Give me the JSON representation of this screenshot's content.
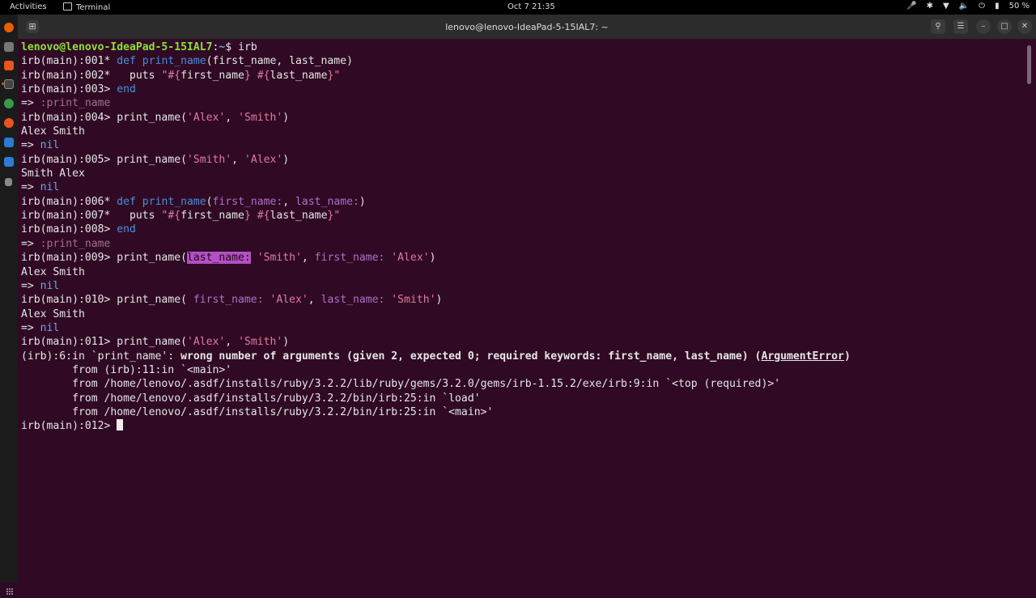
{
  "topbar": {
    "activities": "Activities",
    "app_name": "Terminal",
    "clock": "Oct 7  21:35",
    "battery": "50 %",
    "tray_icons": [
      "microphone-icon",
      "bluetooth-icon",
      "wifi-icon",
      "volume-icon",
      "power-icon",
      "battery-icon"
    ]
  },
  "dock": {
    "apps": [
      "firefox-icon",
      "files-icon",
      "software-icon",
      "terminal-icon",
      "chrome-icon",
      "ubuntu-icon",
      "vscode-icon",
      "text-editor-icon",
      "trash-icon",
      "show-apps-icon"
    ]
  },
  "window": {
    "title": "lenovo@lenovo-IdeaPad-5-15IAL7: ~",
    "new_tab_icon": "new-tab-icon",
    "buttons": {
      "search": "search-icon",
      "menu": "hamburger-icon",
      "minimize": "minimize-icon",
      "maximize": "maximize-icon",
      "close": "close-icon"
    }
  },
  "terminal": {
    "prompt_user": "lenovo@lenovo-IdeaPad-5-15IAL7",
    "prompt_path": "~",
    "first_command": "irb",
    "p001": "irb(main):001* ",
    "p002": "irb(main):002*   ",
    "p003": "irb(main):003> ",
    "p004": "irb(main):004> ",
    "p005": "irb(main):005> ",
    "p006": "irb(main):006* ",
    "p007": "irb(main):007*   ",
    "p008": "irb(main):008> ",
    "p009": "irb(main):009> ",
    "p010": "irb(main):010> ",
    "p011": "irb(main):011> ",
    "p012": "irb(main):012> ",
    "kw_def": "def",
    "kw_end": "end",
    "kw_puts": "puts",
    "method_name": "print_name",
    "params_positional": "(first_name, last_name)",
    "params_keyword_open": "(",
    "params_keyword_first": "first_name:",
    "params_keyword_sep": ", ",
    "params_keyword_last": "last_name:",
    "params_keyword_close": ")",
    "interp_open_q": "\"#{",
    "interp_first": "first_name",
    "interp_mid": "} #{",
    "interp_last": "last_name",
    "interp_close_q": "}\"",
    "arrow": "=> ",
    "sym_print_name": ":print_name",
    "nil": "nil",
    "call_open": "print_name(",
    "call_open_space": "print_name( ",
    "call_close": ")",
    "comma": ", ",
    "str_alex": "'Alex'",
    "str_smith": "'Smith'",
    "out_alex_smith": "Alex Smith",
    "out_smith_alex": "Smith Alex",
    "kw_last_name": "last_name:",
    "kw_first_name": "first_name:",
    "err_prefix": "(irb):6:in `print_name': ",
    "err_msg": "wrong number of arguments (given 2, expected 0; required keywords: first_name, last_name) (",
    "err_class": "ArgumentError",
    "err_close": ")",
    "bt1": "        from (irb):11:in `<main>'",
    "bt2": "        from /home/lenovo/.asdf/installs/ruby/3.2.2/lib/ruby/gems/3.2.0/gems/irb-1.15.2/exe/irb:9:in `<top (required)>'",
    "bt3": "        from /home/lenovo/.asdf/installs/ruby/3.2.2/bin/irb:25:in `load'",
    "bt4": "        from /home/lenovo/.asdf/installs/ruby/3.2.2/bin/irb:25:in `<main>'"
  }
}
